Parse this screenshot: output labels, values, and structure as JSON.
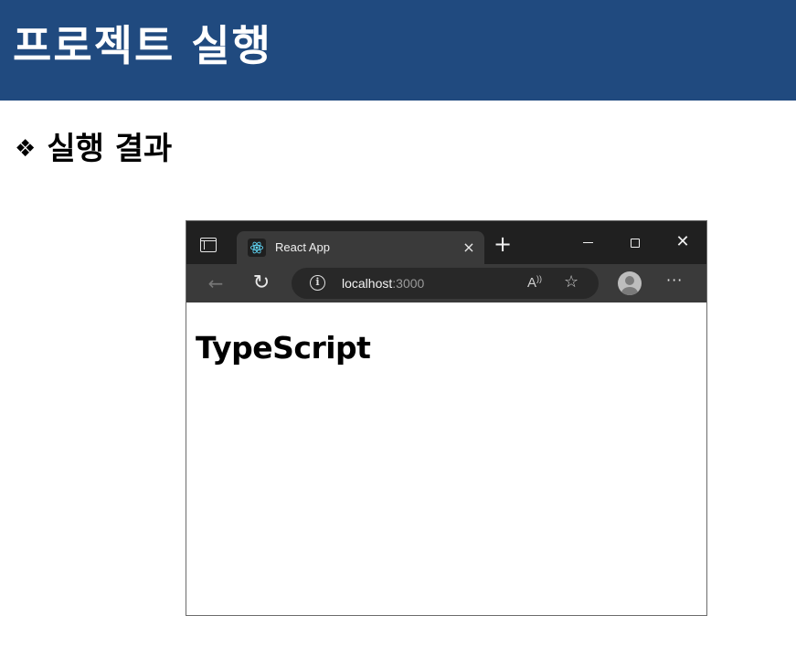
{
  "slide": {
    "title": "프로젝트 실행",
    "bullet": "❖",
    "section_heading": "실행 결과"
  },
  "browser": {
    "tab_title": "React App",
    "tab_close": "×",
    "new_tab": "+",
    "window_close": "✕",
    "back": "←",
    "refresh": "↻",
    "info": "i",
    "url_host": "localhost",
    "url_port": ":3000",
    "read_aloud": "A",
    "favorites": "☆",
    "more": "···",
    "page_heading": "TypeScript"
  },
  "colors": {
    "header_bg": "#204a7f",
    "tabbar_bg": "#202020",
    "toolbar_bg": "#3a3a3a",
    "react_logo": "#61dafb"
  },
  "icons": [
    "tab-actions-icon",
    "react-logo-icon",
    "close-icon",
    "plus-icon",
    "minimize-icon",
    "maximize-icon",
    "back-arrow-icon",
    "refresh-icon",
    "info-icon",
    "read-aloud-icon",
    "favorites-icon",
    "profile-icon",
    "more-icon"
  ]
}
